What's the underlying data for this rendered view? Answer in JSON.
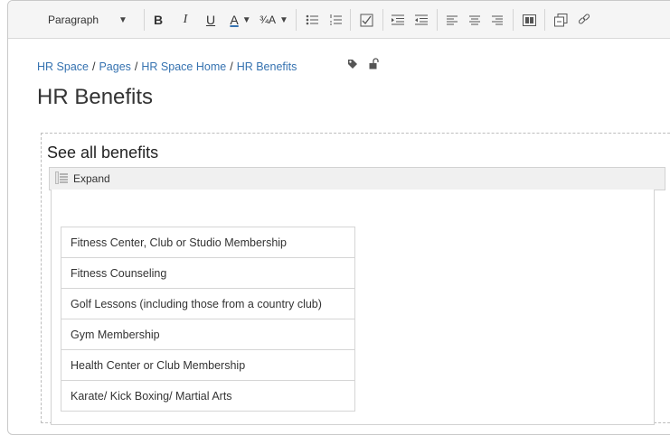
{
  "toolbar": {
    "paragraph_label": "Paragraph",
    "icons": [
      "bold-icon",
      "italic-icon",
      "underline-icon",
      "text-color-icon",
      "clear-format-icon",
      "bullet-list-icon",
      "numbered-list-icon",
      "task-list-icon",
      "outdent-icon",
      "indent-icon",
      "align-left-icon",
      "align-center-icon",
      "align-right-icon",
      "page-layout-icon",
      "insert-file-icon",
      "link-icon"
    ]
  },
  "breadcrumb": {
    "items": [
      "HR Space",
      "Pages",
      "HR Space Home",
      "HR Benefits"
    ]
  },
  "page": {
    "title": "HR Benefits"
  },
  "macro": {
    "heading": "See all benefits",
    "expand_label": "Expand"
  },
  "benefits": [
    "Fitness Center, Club or Studio Membership",
    "Fitness Counseling",
    "Golf Lessons (including those from a country club)",
    "Gym Membership",
    "Health Center or Club Membership",
    "Karate/ Kick Boxing/ Martial Arts"
  ]
}
